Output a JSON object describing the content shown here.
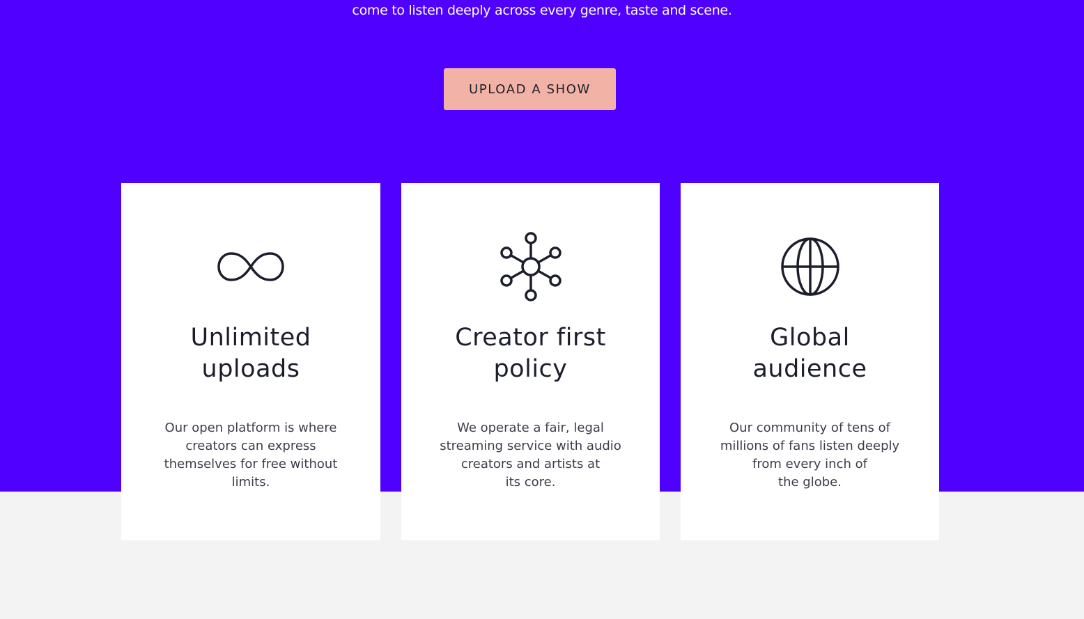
{
  "hero": {
    "tagline": "come to listen deeply across every genre, taste and scene.",
    "cta_label": "UPLOAD A SHOW",
    "background_color": "#5000ff",
    "cta_color": "#f2b2a5"
  },
  "features": [
    {
      "icon": "infinity-icon",
      "title_line1": "Unlimited",
      "title_line2": "uploads",
      "desc_line1": "Our open platform is where",
      "desc_line2": "creators can express",
      "desc_line3": "themselves for free without",
      "desc_line4": "limits."
    },
    {
      "icon": "network-icon",
      "title_line1": "Creator first",
      "title_line2": "policy",
      "desc_line1": "We operate a fair, legal",
      "desc_line2": "streaming service with audio",
      "desc_line3": "creators and artists at",
      "desc_line4": "its core."
    },
    {
      "icon": "globe-icon",
      "title_line1": "Global",
      "title_line2": "audience",
      "desc_line1": "Our community of tens of",
      "desc_line2": "millions of fans listen deeply",
      "desc_line3": "from every inch of",
      "desc_line4": "the globe."
    }
  ]
}
